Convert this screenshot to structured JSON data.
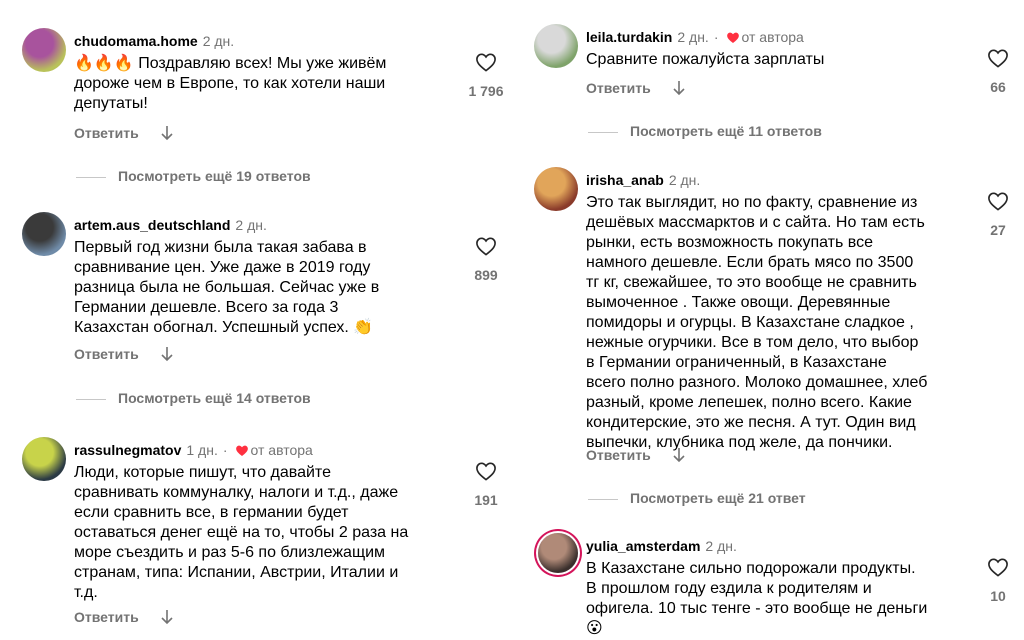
{
  "left": [
    {
      "username": "chudomama.home",
      "time": "2 дн.",
      "text_lines": [
        "🔥🔥🔥 Поздравляю всех! Мы уже живём",
        "дороже чем в Европе, то как хотели наши",
        "депутаты!"
      ],
      "likes": "1 796",
      "reply": "Ответить",
      "more_replies": "Посмотреть ещё 19 ответов",
      "avatar_colors": [
        "#b9c25a",
        "#a8539d"
      ]
    },
    {
      "username": "artem.aus_deutschland",
      "time": "2 дн.",
      "text_lines": [
        "Первый год жизни была такая забава в",
        "сравнивание цен.  Уже даже в 2019 году",
        "разница была не большая. Сейчас уже в",
        "Германии дешевле. Всего за года 3",
        "Казахстан обогнал.  Успешный успех. 👏"
      ],
      "likes": "899",
      "reply": "Ответить",
      "more_replies": "Посмотреть ещё 14 ответов",
      "avatar_colors": [
        "#6f8ba8",
        "#3a3a3a"
      ]
    },
    {
      "username": "rassulnegmatov",
      "time": "1 дн.",
      "by_author": "от автора",
      "text_lines": [
        "Люди, которые пишут, что давайте",
        "сравнивать коммуналку, налоги и т.д., даже",
        "если сравнить все, в германии будет",
        "оставаться денег ещё на то, чтобы 2 раза на",
        "море съездить и раз 5-6 по близлежащим",
        "странам, типа: Испании, Австрии, Италии и",
        "т.д."
      ],
      "likes": "191",
      "reply": "Ответить",
      "avatar_colors": [
        "#2b3a44",
        "#c8d34a"
      ]
    }
  ],
  "right": [
    {
      "username": "leila.turdakin",
      "time": "2 дн.",
      "by_author": "от автора",
      "text_lines": [
        "Сравните пожалуйста зарплаты"
      ],
      "likes": "66",
      "reply": "Ответить",
      "more_replies": "Посмотреть ещё 11 ответов",
      "avatar_colors": [
        "#7fa36a",
        "#d9d9d9"
      ]
    },
    {
      "username": "irisha_anab",
      "time": "2 дн.",
      "text_lines": [
        "Это так выглядит, но по факту, сравнение из",
        "дешёвых массмарктов и с сайта. Но там есть",
        "рынки, есть возможность покупать  все",
        "намного дешевле. Если брать мясо по 3500",
        "тг кг, свежайшее, то это вообще не сравнить",
        "вымоченное .  Также овощи. Деревянные",
        "помидоры и огурцы. В Казахстане сладкое ,",
        "нежные огурчики. Все в том дело, что выбор",
        "в Германии  ограниченный, в Казахстане",
        "всего полно разного. Молоко домашнее, хлеб",
        "разный, кроме лепешек, полно всего. Какие",
        "кондитерские, это же песня. А тут. Один вид",
        "выпечки, клубника под желе, да пончики."
      ],
      "likes": "27",
      "reply": "Ответить",
      "more_replies": "Посмотреть ещё 21 ответ",
      "avatar_colors": [
        "#8a3b2a",
        "#e1a55a"
      ]
    },
    {
      "username": "yulia_amsterdam",
      "time": "2 дн.",
      "text_lines": [
        "В Казахстане сильно подорожали продукты.",
        "В прошлом году ездила к родителям и",
        "офигела. 10 тыс тенге - это вообще не деньги",
        "😮"
      ],
      "likes": "10",
      "avatar_colors": [
        "#3a2f2c",
        "#b08a78"
      ]
    }
  ],
  "colors": {
    "muted": "#737373",
    "accent_heart": "#ff3040",
    "story_ring": "#d4145a"
  },
  "icons": {
    "like": "heart-outline-icon",
    "author_like": "heart-filled-icon",
    "translate": "arrow-down-icon"
  }
}
